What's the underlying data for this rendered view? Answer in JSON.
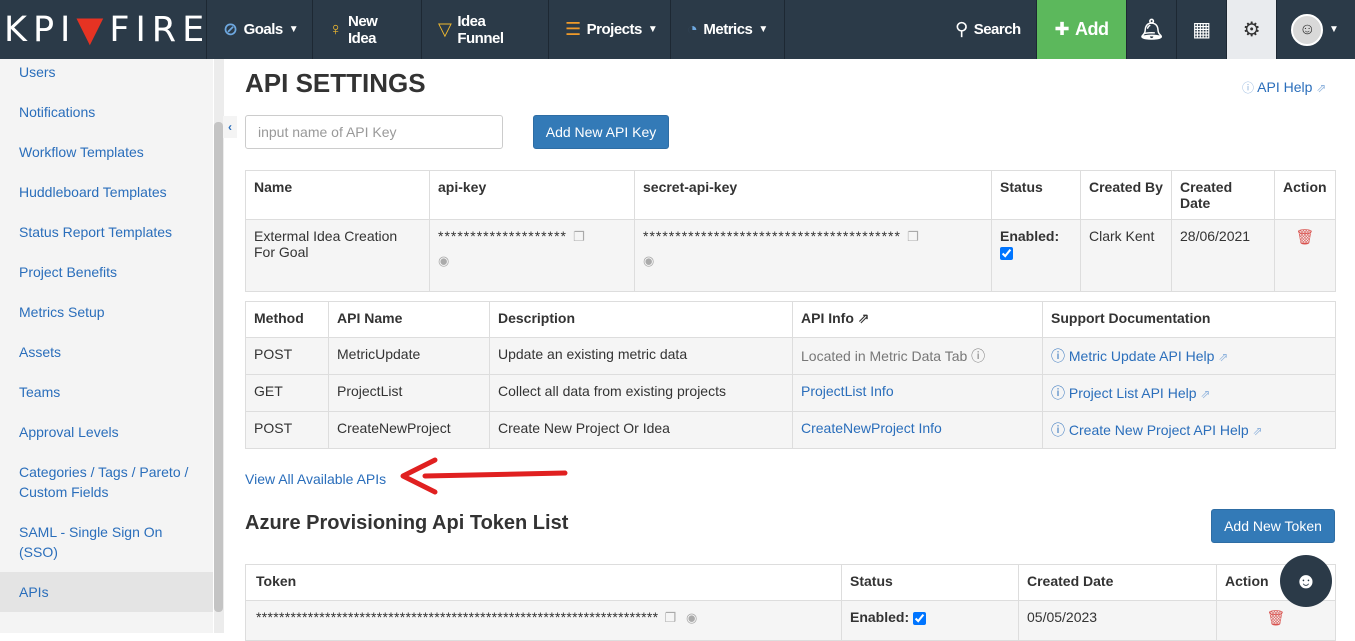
{
  "nav": {
    "logo_pre": "KPI",
    "logo_post": "FIRE",
    "goals": "Goals",
    "new_idea": "New Idea",
    "idea_funnel": "Idea Funnel",
    "projects": "Projects",
    "metrics": "Metrics",
    "search": "Search",
    "add": "Add",
    "icons": [
      "compass-icon",
      "lightbulb-icon",
      "funnel-icon",
      "projects-icon",
      "gauge-icon",
      "search-icon",
      "bell-icon",
      "grid-icon",
      "gear-icon",
      "avatar"
    ]
  },
  "sidebar": {
    "items": [
      {
        "label": "Users"
      },
      {
        "label": "Notifications"
      },
      {
        "label": "Workflow Templates"
      },
      {
        "label": "Huddleboard Templates"
      },
      {
        "label": "Status Report Templates"
      },
      {
        "label": "Project Benefits"
      },
      {
        "label": "Metrics Setup"
      },
      {
        "label": "Assets"
      },
      {
        "label": "Teams"
      },
      {
        "label": "Approval Levels"
      },
      {
        "label": "Categories / Tags / Pareto / Custom Fields"
      },
      {
        "label": "SAML - Single Sign On (SSO)"
      },
      {
        "label": "APIs"
      }
    ],
    "active": "APIs"
  },
  "main": {
    "title": "API SETTINGS",
    "api_help": "API Help",
    "key_input_placeholder": "input name of API Key",
    "add_key_button": "Add New API Key",
    "keys_table": {
      "headers": [
        "Name",
        "api-key",
        "secret-api-key",
        "Status",
        "Created By",
        "Created Date",
        "Action"
      ],
      "rows": [
        {
          "name": "Extermal Idea Creation For Goal",
          "api_key": "********************",
          "secret_key": "****************************************",
          "status": "Enabled:",
          "status_checked": true,
          "created_by": "Clark Kent",
          "created_date": "28/06/2021"
        }
      ]
    },
    "apis_table": {
      "headers": [
        "Method",
        "API Name",
        "Description",
        "API Info",
        "Support Documentation"
      ],
      "rows": [
        {
          "method": "POST",
          "name": "MetricUpdate",
          "description": "Update an existing metric data",
          "info": "Located in Metric Data Tab",
          "info_link": false,
          "doc": "Metric Update API Help"
        },
        {
          "method": "GET",
          "name": "ProjectList",
          "description": "Collect all data from existing projects",
          "info": "ProjectList Info",
          "info_link": true,
          "doc": "Project List API Help"
        },
        {
          "method": "POST",
          "name": "CreateNewProject",
          "description": "Create New Project Or Idea",
          "info": "CreateNewProject Info",
          "info_link": true,
          "doc": "Create New Project API Help"
        }
      ]
    },
    "view_all": "View All Available APIs",
    "azure_title": "Azure Provisioning Api Token List",
    "add_token_button": "Add New Token",
    "token_table": {
      "headers": [
        "Token",
        "Status",
        "Created Date",
        "Action"
      ],
      "rows": [
        {
          "token": "**********************************************************************",
          "status": "Enabled:",
          "status_checked": true,
          "created_date": "05/05/2023"
        }
      ]
    }
  }
}
